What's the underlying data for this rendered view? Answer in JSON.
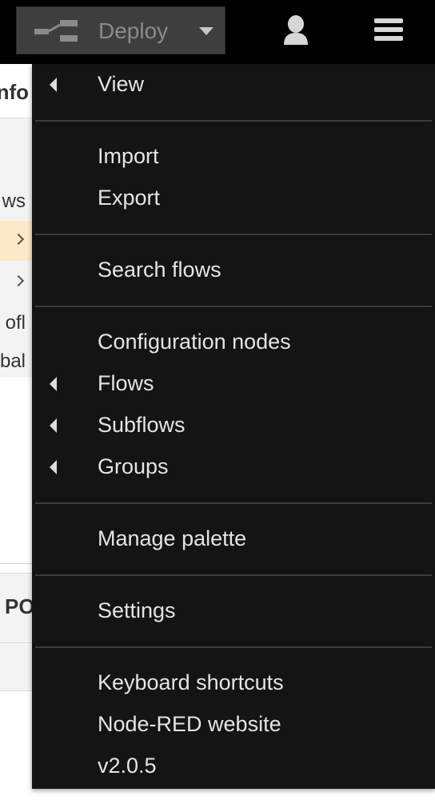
{
  "header": {
    "deploy_label": "Deploy",
    "deploy_icon": "deploy-icon",
    "user_icon": "user-icon",
    "menu_icon": "hamburger-menu-icon"
  },
  "sidebar": {
    "info_tab": "nfo",
    "rows": [
      {
        "text": "ws"
      },
      {
        "text": ""
      },
      {
        "text": ""
      },
      {
        "text": "ofl"
      },
      {
        "text": "obal"
      }
    ],
    "section_title": "PO"
  },
  "menu": {
    "items": [
      {
        "label": "View",
        "submenu": true
      },
      {
        "label": "Import",
        "submenu": false
      },
      {
        "label": "Export",
        "submenu": false
      },
      {
        "label": "Search flows",
        "submenu": false
      },
      {
        "label": "Configuration nodes",
        "submenu": false
      },
      {
        "label": "Flows",
        "submenu": true
      },
      {
        "label": "Subflows",
        "submenu": true
      },
      {
        "label": "Groups",
        "submenu": true
      },
      {
        "label": "Manage palette",
        "submenu": false
      },
      {
        "label": "Settings",
        "submenu": false
      },
      {
        "label": "Keyboard shortcuts",
        "submenu": false
      },
      {
        "label": "Node-RED website",
        "submenu": false
      },
      {
        "label": "v2.0.5",
        "submenu": false
      }
    ]
  },
  "colors": {
    "header_bg": "#000000",
    "menu_bg": "#141414",
    "menu_text": "#e4e4e4",
    "highlight_row": "#fde9c7"
  }
}
